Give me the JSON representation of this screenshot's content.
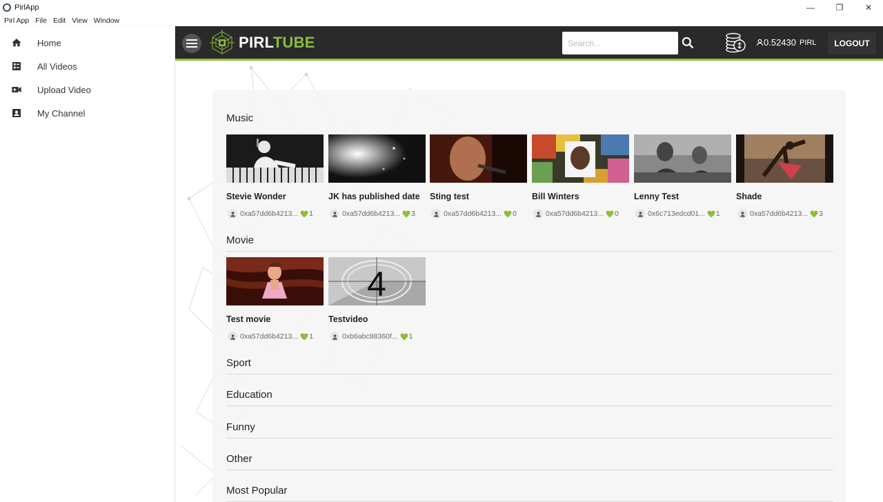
{
  "window": {
    "title": "PirlApp",
    "minimize": "—",
    "restore": "❐",
    "close": "✕"
  },
  "menubar": [
    "Pirl App",
    "File",
    "Edit",
    "View",
    "Window"
  ],
  "sidebar": {
    "items": [
      {
        "label": "Home",
        "icon": "home-icon"
      },
      {
        "label": "All Videos",
        "icon": "video-list-icon"
      },
      {
        "label": "Upload Video",
        "icon": "video-camera-icon"
      },
      {
        "label": "My Channel",
        "icon": "account-box-icon"
      }
    ]
  },
  "topbar": {
    "logo_pirl": "PIRL",
    "logo_tube": "TUBE",
    "search_placeholder": "Search...",
    "balance_value": "0.52430",
    "balance_unit": "PIRL",
    "logout_label": "LOGOUT",
    "accent_color": "#8dbd3a"
  },
  "sections": [
    {
      "title": "Music",
      "videos": [
        {
          "title": "Stevie Wonder",
          "author": "0xa57dd6b4213...",
          "likes": "1"
        },
        {
          "title": "JK has published date",
          "author": "0xa57dd6b4213...",
          "likes": "3"
        },
        {
          "title": "Sting test",
          "author": "0xa57dd6b4213...",
          "likes": "0"
        },
        {
          "title": "Bill Winters",
          "author": "0xa57dd6b4213...",
          "likes": "0"
        },
        {
          "title": "Lenny Test",
          "author": "0x6c713edcd01...",
          "likes": "1"
        },
        {
          "title": "Shade",
          "author": "0xa57dd6b4213...",
          "likes": "3"
        }
      ]
    },
    {
      "title": "Movie",
      "videos": [
        {
          "title": "Test movie",
          "author": "0xa57dd6b4213...",
          "likes": "1"
        },
        {
          "title": "Testvideo",
          "author": "0xb6abc88360f...",
          "likes": "1",
          "thumb_text": "4"
        }
      ]
    },
    {
      "title": "Sport",
      "videos": []
    },
    {
      "title": "Education",
      "videos": []
    },
    {
      "title": "Funny",
      "videos": []
    },
    {
      "title": "Other",
      "videos": []
    },
    {
      "title": "Most Popular",
      "videos": []
    }
  ]
}
